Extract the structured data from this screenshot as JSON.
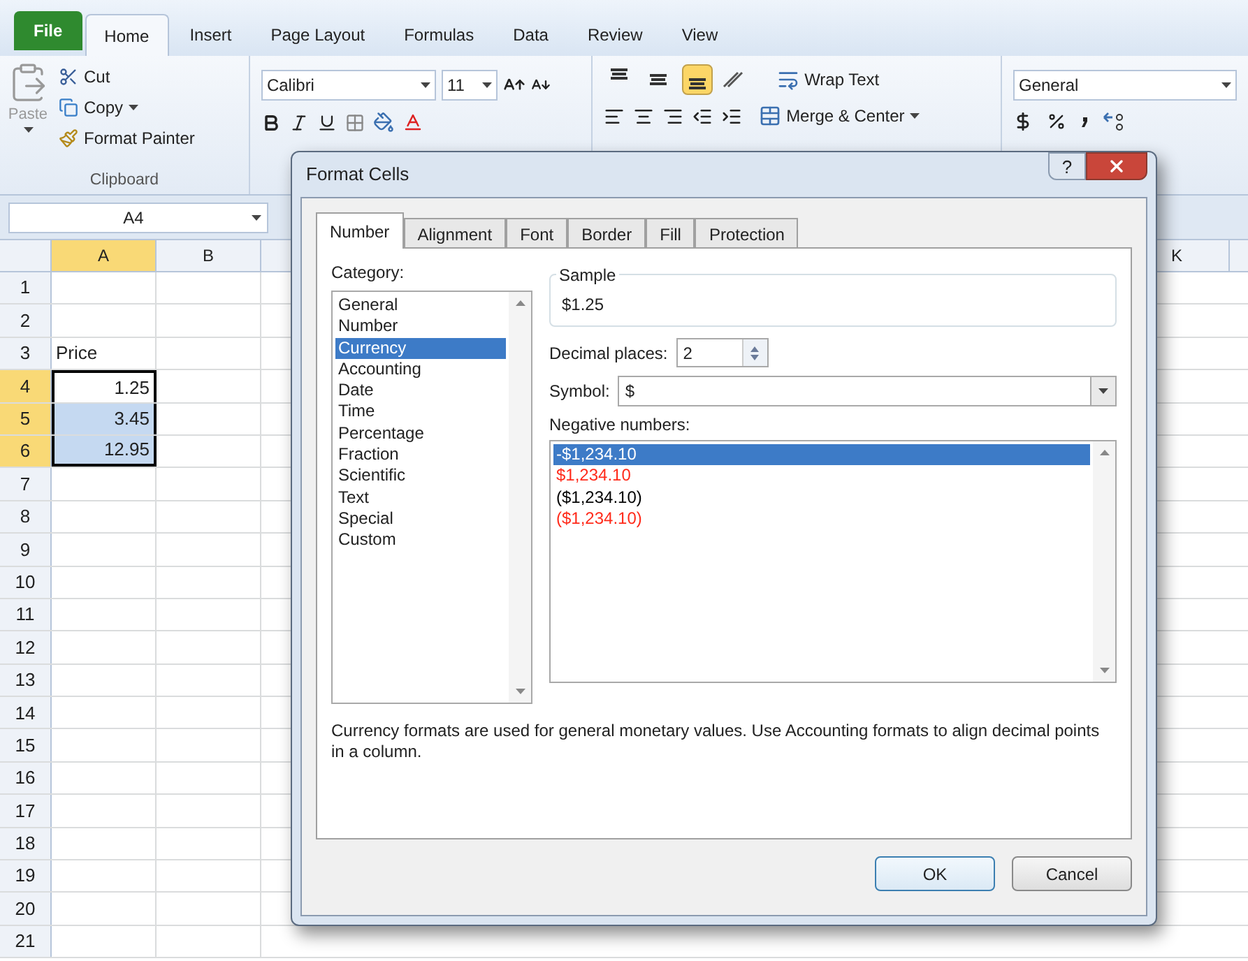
{
  "ribbon_tabs": [
    {
      "label": "File",
      "kind": "file",
      "selected": false
    },
    {
      "label": "Home",
      "kind": "tab",
      "selected": true
    },
    {
      "label": "Insert",
      "kind": "tab",
      "selected": false
    },
    {
      "label": "Page Layout",
      "kind": "tab",
      "selected": false
    },
    {
      "label": "Formulas",
      "kind": "tab",
      "selected": false
    },
    {
      "label": "Data",
      "kind": "tab",
      "selected": false
    },
    {
      "label": "Review",
      "kind": "tab",
      "selected": false
    },
    {
      "label": "View",
      "kind": "tab",
      "selected": false
    }
  ],
  "clipboard": {
    "paste": "Paste",
    "cut": "Cut",
    "copy": "Copy",
    "format_painter": "Format Painter",
    "label": "Clipboard"
  },
  "font": {
    "name": "Calibri",
    "size": "11"
  },
  "alignment": {
    "vertical_buttons": [
      {
        "selected": false
      },
      {
        "selected": false
      },
      {
        "selected": true
      }
    ],
    "wrap_text": "Wrap Text",
    "merge_center": "Merge & Center"
  },
  "number": {
    "format": "General"
  },
  "name_box": "A4",
  "columns": [
    {
      "label": "A",
      "selected": true
    },
    {
      "label": "B",
      "selected": false
    },
    {
      "label": "K",
      "selected": false
    }
  ],
  "rows": [
    {
      "label": "1",
      "selected": false
    },
    {
      "label": "2",
      "selected": false
    },
    {
      "label": "3",
      "selected": false,
      "value": "Price",
      "kind": "text"
    },
    {
      "label": "4",
      "selected": true,
      "active": true,
      "value": "1.25",
      "kind": "number"
    },
    {
      "label": "5",
      "selected": true,
      "active": false,
      "value": "3.45",
      "kind": "number"
    },
    {
      "label": "6",
      "selected": true,
      "active": false,
      "value": "12.95",
      "kind": "number"
    },
    {
      "label": "7",
      "selected": false
    },
    {
      "label": "8",
      "selected": false
    },
    {
      "label": "9",
      "selected": false
    },
    {
      "label": "10",
      "selected": false
    },
    {
      "label": "11",
      "selected": false
    },
    {
      "label": "12",
      "selected": false
    },
    {
      "label": "13",
      "selected": false
    },
    {
      "label": "14",
      "selected": false
    },
    {
      "label": "15",
      "selected": false
    },
    {
      "label": "16",
      "selected": false
    },
    {
      "label": "17",
      "selected": false
    },
    {
      "label": "18",
      "selected": false
    },
    {
      "label": "19",
      "selected": false
    },
    {
      "label": "20",
      "selected": false
    },
    {
      "label": "21",
      "selected": false
    }
  ],
  "dialog": {
    "title": "Format Cells",
    "help": "?",
    "tabs": [
      {
        "label": "Number",
        "selected": true
      },
      {
        "label": "Alignment",
        "selected": false
      },
      {
        "label": "Font",
        "selected": false
      },
      {
        "label": "Border",
        "selected": false
      },
      {
        "label": "Fill",
        "selected": false
      },
      {
        "label": "Protection",
        "selected": false
      }
    ],
    "category_label": "Category:",
    "categories": [
      {
        "label": "General",
        "selected": false
      },
      {
        "label": "Number",
        "selected": false
      },
      {
        "label": "Currency",
        "selected": true
      },
      {
        "label": "Accounting",
        "selected": false
      },
      {
        "label": "Date",
        "selected": false
      },
      {
        "label": "Time",
        "selected": false
      },
      {
        "label": "Percentage",
        "selected": false
      },
      {
        "label": "Fraction",
        "selected": false
      },
      {
        "label": "Scientific",
        "selected": false
      },
      {
        "label": "Text",
        "selected": false
      },
      {
        "label": "Special",
        "selected": false
      },
      {
        "label": "Custom",
        "selected": false
      }
    ],
    "sample_label": "Sample",
    "sample_value": "$1.25",
    "decimal_label": "Decimal places:",
    "decimal_value": "2",
    "symbol_label": "Symbol:",
    "symbol_value": "$",
    "negative_label": "Negative numbers:",
    "negative_numbers": [
      {
        "label": "-$1,234.10",
        "selected": true
      },
      {
        "label": "$1,234.10",
        "selected": false,
        "color": "#ff2a1a"
      },
      {
        "label": "($1,234.10)",
        "selected": false,
        "color": "#000000"
      },
      {
        "label": "($1,234.10)",
        "selected": false,
        "color": "#ff2a1a"
      }
    ],
    "description": "Currency formats are used for general monetary values.  Use Accounting formats to align decimal points in a column.",
    "ok": "OK",
    "cancel": "Cancel"
  }
}
